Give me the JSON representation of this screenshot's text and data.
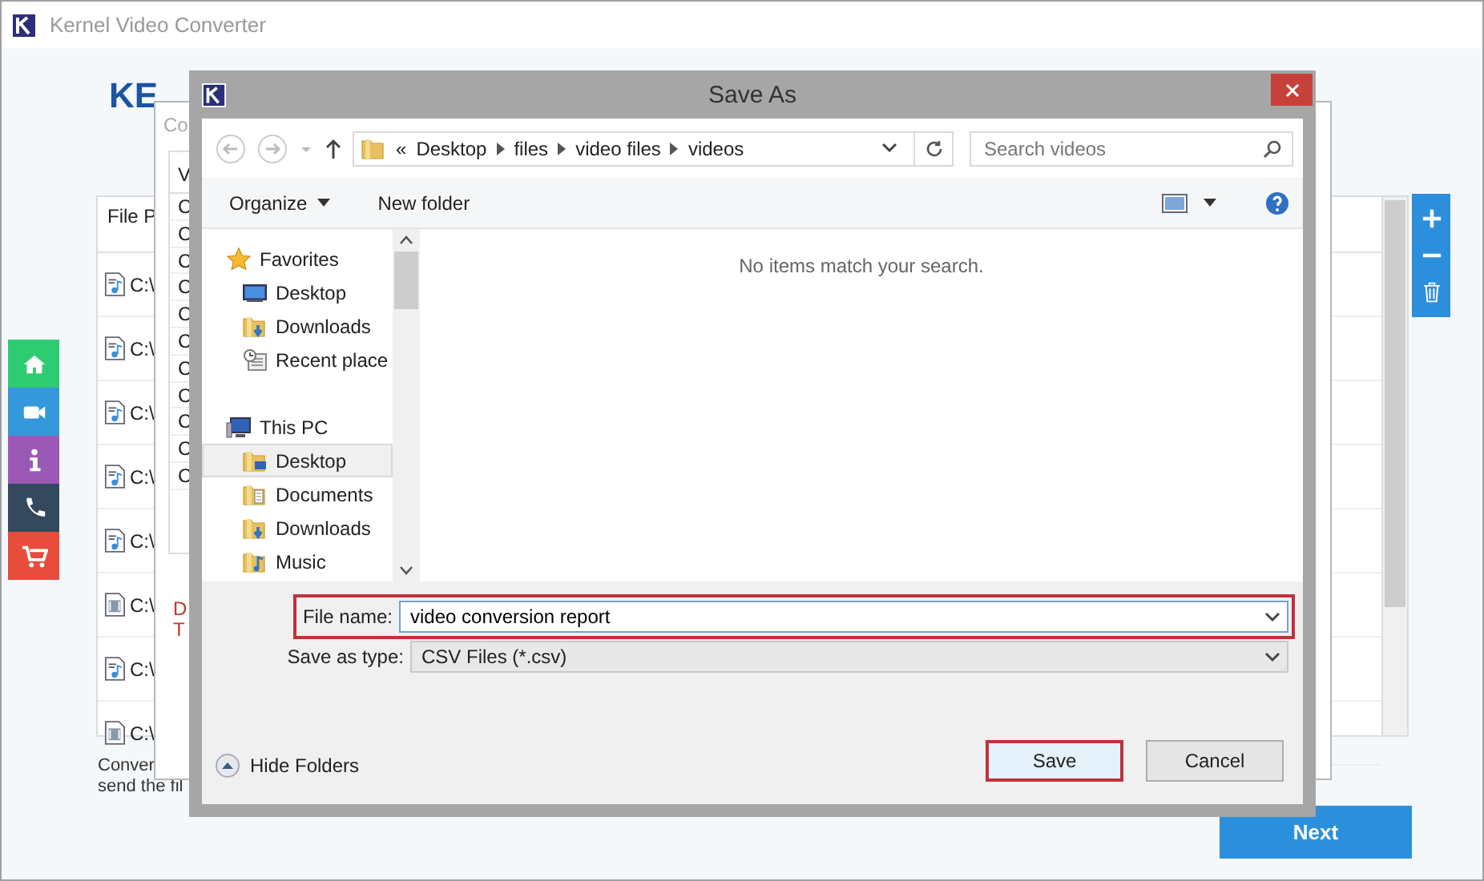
{
  "app": {
    "title": "Kernel Video Converter",
    "logo": "KE",
    "table": {
      "header": "File P",
      "rows": [
        {
          "kind": "audio",
          "text": "C:\\"
        },
        {
          "kind": "audio",
          "text": "C:\\"
        },
        {
          "kind": "audio",
          "text": "C:\\"
        },
        {
          "kind": "audio",
          "text": "C:\\"
        },
        {
          "kind": "audio",
          "text": "C:\\"
        },
        {
          "kind": "video",
          "text": "C:\\"
        },
        {
          "kind": "audio",
          "text": "C:\\"
        },
        {
          "kind": "video",
          "text": "C:\\"
        }
      ]
    },
    "footer_lines": [
      "Conver",
      "send the fil"
    ],
    "sidebar": [
      {
        "kind": "home",
        "color": "#2ecc71"
      },
      {
        "kind": "video",
        "color": "#3498db"
      },
      {
        "kind": "info",
        "color": "#9b59b6"
      },
      {
        "kind": "phone",
        "color": "#34495e"
      },
      {
        "kind": "cart",
        "color": "#e74c3c"
      }
    ],
    "toolbar": [
      {
        "kind": "add"
      },
      {
        "kind": "remove"
      },
      {
        "kind": "delete"
      }
    ],
    "next_button": "Next"
  },
  "background_window": {
    "title": "Co",
    "header": "V",
    "rows": [
      "C",
      "C",
      "C",
      "C",
      "C",
      "C",
      "C",
      "C",
      "C",
      "C",
      "C"
    ],
    "note_lines": [
      "D",
      "T"
    ]
  },
  "dialog": {
    "title": "Save As",
    "breadcrumb": {
      "overflow": "«",
      "parts": [
        "Desktop",
        "files",
        "video files",
        "videos"
      ]
    },
    "search": {
      "placeholder": "Search videos"
    },
    "commands": {
      "organize": "Organize",
      "new_folder": "New folder"
    },
    "navigation": [
      {
        "label": "Favorites",
        "kind": "favorites",
        "selected": false,
        "children": [
          {
            "label": "Desktop",
            "kind": "desktop",
            "selected": false
          },
          {
            "label": "Downloads",
            "kind": "downloads",
            "selected": false
          },
          {
            "label": "Recent place",
            "kind": "recent",
            "selected": false
          }
        ]
      },
      {
        "label": "This PC",
        "kind": "pc",
        "selected": false,
        "children": [
          {
            "label": "Desktop",
            "kind": "desktop-folder",
            "selected": true
          },
          {
            "label": "Documents",
            "kind": "documents",
            "selected": false
          },
          {
            "label": "Downloads",
            "kind": "downloads",
            "selected": false
          },
          {
            "label": "Music",
            "kind": "music",
            "selected": false
          }
        ]
      }
    ],
    "empty_message": "No items match your search.",
    "file_name": {
      "label": "File name:",
      "value": "video conversion report",
      "highlighted": true
    },
    "save_as_type": {
      "label": "Save as type:",
      "value": "CSV Files (*.csv)"
    },
    "hide_folders": "Hide Folders",
    "buttons": [
      {
        "label": "Save",
        "highlighted": true
      },
      {
        "label": "Cancel",
        "highlighted": false
      }
    ]
  }
}
